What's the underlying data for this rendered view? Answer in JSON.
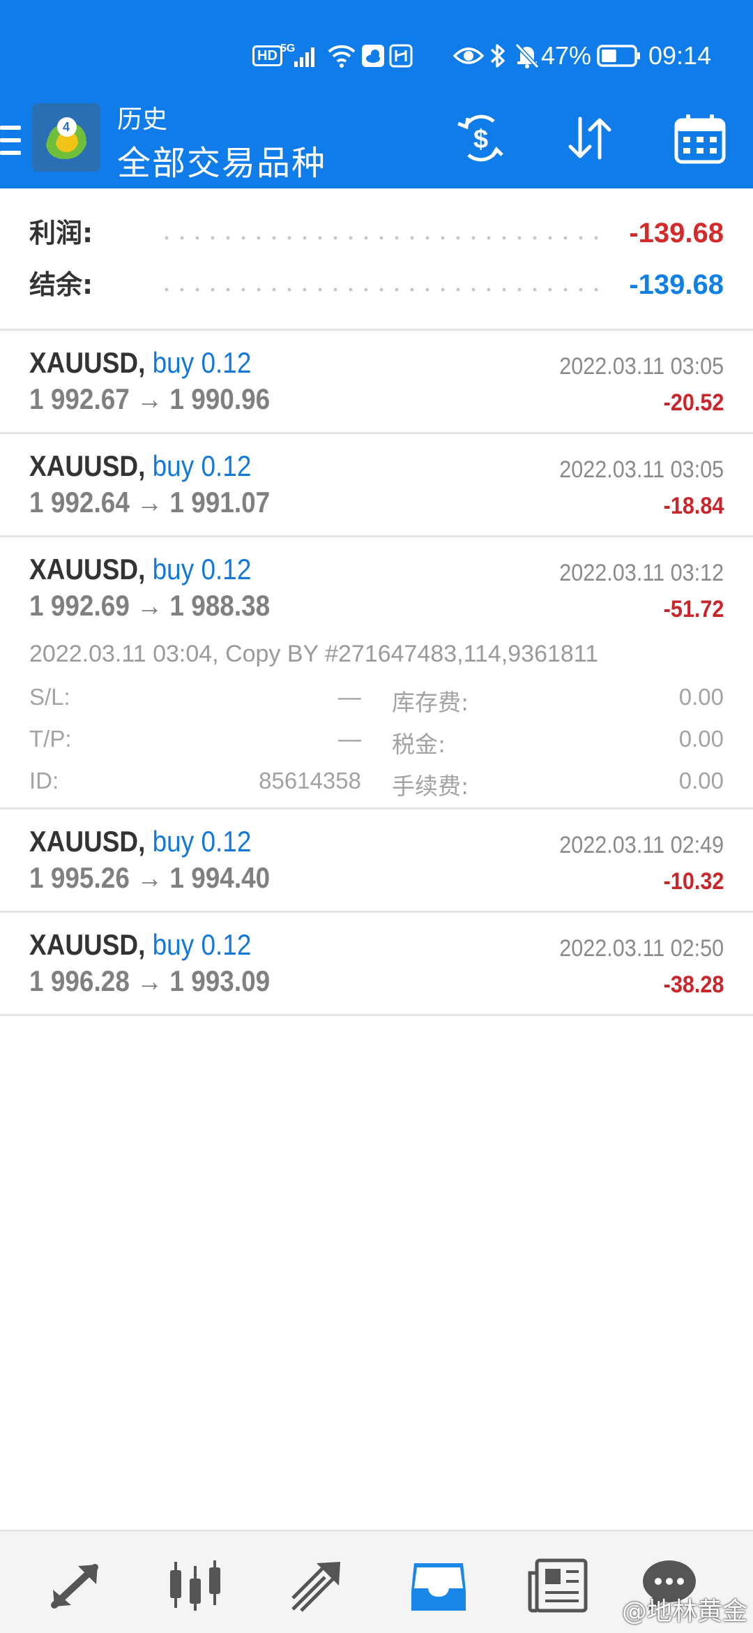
{
  "status_bar": {
    "hd": "HD",
    "network": "5G",
    "battery_percent": "47%",
    "battery_level": 0.47,
    "time": "09:14"
  },
  "app_bar": {
    "title": "历史",
    "subtitle": "全部交易品种",
    "icons": [
      "menu-icon",
      "metatrader-logo",
      "currency-exchange-icon",
      "sort-icon",
      "calendar-icon"
    ]
  },
  "summary": {
    "profit_label": "利润:",
    "profit_value": "-139.68",
    "balance_label": "结余:",
    "balance_value": "-139.68"
  },
  "trades": [
    {
      "symbol": "XAUUSD,",
      "direction": "buy 0.12",
      "prices": "1 992.67 → 1 990.96",
      "time": "2022.03.11 03:05",
      "profit": "-20.52"
    },
    {
      "symbol": "XAUUSD,",
      "direction": "buy 0.12",
      "prices": "1 992.64 → 1 991.07",
      "time": "2022.03.11 03:05",
      "profit": "-18.84"
    },
    {
      "symbol": "XAUUSD,",
      "direction": "buy 0.12",
      "prices": "1 992.69 → 1 988.38",
      "time": "2022.03.11 03:12",
      "profit": "-51.72",
      "comment": "2022.03.11 03:04, Copy BY #271647483,114,9361811",
      "details": {
        "sl_label": "S/L:",
        "sl_value": "—",
        "tp_label": "T/P:",
        "tp_value": "—",
        "id_label": "ID:",
        "id_value": "85614358",
        "swap_label": "库存费:",
        "swap_value": "0.00",
        "tax_label": "税金:",
        "tax_value": "0.00",
        "commission_label": "手续费:",
        "commission_value": "0.00"
      }
    },
    {
      "symbol": "XAUUSD,",
      "direction": "buy 0.12",
      "prices": "1 995.26 → 1 994.40",
      "time": "2022.03.11 02:49",
      "profit": "-10.32"
    },
    {
      "symbol": "XAUUSD,",
      "direction": "buy 0.12",
      "prices": "1 996.28 → 1 993.09",
      "time": "2022.03.11 02:50",
      "profit": "-38.28"
    }
  ],
  "bottom_nav": {
    "items": [
      "quotes-icon",
      "chart-icon",
      "trade-icon",
      "history-icon",
      "news-icon",
      "chat-icon"
    ],
    "active": "history-icon"
  },
  "watermark": "@地林黄金",
  "colors": {
    "header_bg": "#0f7cea",
    "negative": "#d42a2a",
    "positive_blue": "#1080e4",
    "direction_blue": "#1478d9",
    "active_nav": "#1a86e8",
    "inactive_nav": "#555555"
  }
}
